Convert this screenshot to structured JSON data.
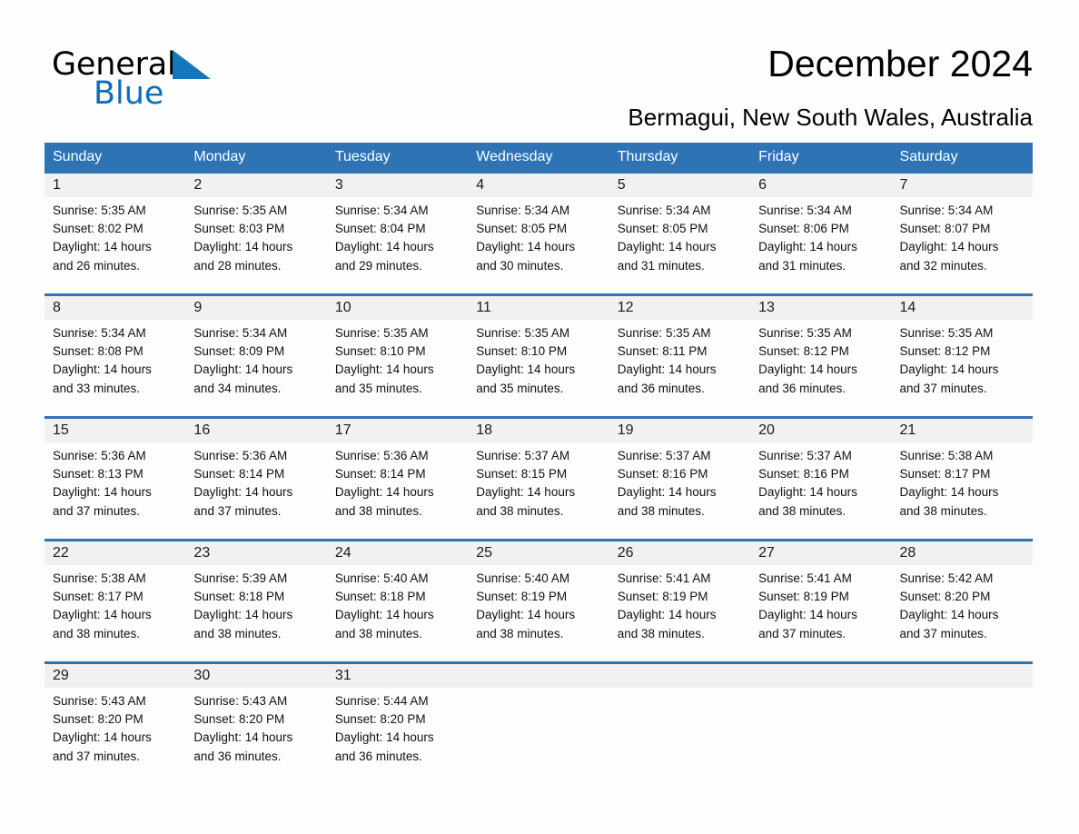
{
  "logo": {
    "text_general": "General",
    "text_blue": "Blue",
    "triangle_color": "#1476bc",
    "blue_color": "#0a6ebd"
  },
  "header": {
    "title": "December 2024",
    "subtitle": "Bermagui, New South Wales, Australia"
  },
  "theme": {
    "header_blue": "#2e74b5",
    "day_number_bg": "#f1f1f1",
    "page_bg": "#fdfdfd"
  },
  "calendar": {
    "day_names": [
      "Sunday",
      "Monday",
      "Tuesday",
      "Wednesday",
      "Thursday",
      "Friday",
      "Saturday"
    ],
    "weeks": [
      [
        {
          "day": "1",
          "sunrise": "Sunrise: 5:35 AM",
          "sunset": "Sunset: 8:02 PM",
          "daylight_line1": "Daylight: 14 hours",
          "daylight_line2": "and 26 minutes."
        },
        {
          "day": "2",
          "sunrise": "Sunrise: 5:35 AM",
          "sunset": "Sunset: 8:03 PM",
          "daylight_line1": "Daylight: 14 hours",
          "daylight_line2": "and 28 minutes."
        },
        {
          "day": "3",
          "sunrise": "Sunrise: 5:34 AM",
          "sunset": "Sunset: 8:04 PM",
          "daylight_line1": "Daylight: 14 hours",
          "daylight_line2": "and 29 minutes."
        },
        {
          "day": "4",
          "sunrise": "Sunrise: 5:34 AM",
          "sunset": "Sunset: 8:05 PM",
          "daylight_line1": "Daylight: 14 hours",
          "daylight_line2": "and 30 minutes."
        },
        {
          "day": "5",
          "sunrise": "Sunrise: 5:34 AM",
          "sunset": "Sunset: 8:05 PM",
          "daylight_line1": "Daylight: 14 hours",
          "daylight_line2": "and 31 minutes."
        },
        {
          "day": "6",
          "sunrise": "Sunrise: 5:34 AM",
          "sunset": "Sunset: 8:06 PM",
          "daylight_line1": "Daylight: 14 hours",
          "daylight_line2": "and 31 minutes."
        },
        {
          "day": "7",
          "sunrise": "Sunrise: 5:34 AM",
          "sunset": "Sunset: 8:07 PM",
          "daylight_line1": "Daylight: 14 hours",
          "daylight_line2": "and 32 minutes."
        }
      ],
      [
        {
          "day": "8",
          "sunrise": "Sunrise: 5:34 AM",
          "sunset": "Sunset: 8:08 PM",
          "daylight_line1": "Daylight: 14 hours",
          "daylight_line2": "and 33 minutes."
        },
        {
          "day": "9",
          "sunrise": "Sunrise: 5:34 AM",
          "sunset": "Sunset: 8:09 PM",
          "daylight_line1": "Daylight: 14 hours",
          "daylight_line2": "and 34 minutes."
        },
        {
          "day": "10",
          "sunrise": "Sunrise: 5:35 AM",
          "sunset": "Sunset: 8:10 PM",
          "daylight_line1": "Daylight: 14 hours",
          "daylight_line2": "and 35 minutes."
        },
        {
          "day": "11",
          "sunrise": "Sunrise: 5:35 AM",
          "sunset": "Sunset: 8:10 PM",
          "daylight_line1": "Daylight: 14 hours",
          "daylight_line2": "and 35 minutes."
        },
        {
          "day": "12",
          "sunrise": "Sunrise: 5:35 AM",
          "sunset": "Sunset: 8:11 PM",
          "daylight_line1": "Daylight: 14 hours",
          "daylight_line2": "and 36 minutes."
        },
        {
          "day": "13",
          "sunrise": "Sunrise: 5:35 AM",
          "sunset": "Sunset: 8:12 PM",
          "daylight_line1": "Daylight: 14 hours",
          "daylight_line2": "and 36 minutes."
        },
        {
          "day": "14",
          "sunrise": "Sunrise: 5:35 AM",
          "sunset": "Sunset: 8:12 PM",
          "daylight_line1": "Daylight: 14 hours",
          "daylight_line2": "and 37 minutes."
        }
      ],
      [
        {
          "day": "15",
          "sunrise": "Sunrise: 5:36 AM",
          "sunset": "Sunset: 8:13 PM",
          "daylight_line1": "Daylight: 14 hours",
          "daylight_line2": "and 37 minutes."
        },
        {
          "day": "16",
          "sunrise": "Sunrise: 5:36 AM",
          "sunset": "Sunset: 8:14 PM",
          "daylight_line1": "Daylight: 14 hours",
          "daylight_line2": "and 37 minutes."
        },
        {
          "day": "17",
          "sunrise": "Sunrise: 5:36 AM",
          "sunset": "Sunset: 8:14 PM",
          "daylight_line1": "Daylight: 14 hours",
          "daylight_line2": "and 38 minutes."
        },
        {
          "day": "18",
          "sunrise": "Sunrise: 5:37 AM",
          "sunset": "Sunset: 8:15 PM",
          "daylight_line1": "Daylight: 14 hours",
          "daylight_line2": "and 38 minutes."
        },
        {
          "day": "19",
          "sunrise": "Sunrise: 5:37 AM",
          "sunset": "Sunset: 8:16 PM",
          "daylight_line1": "Daylight: 14 hours",
          "daylight_line2": "and 38 minutes."
        },
        {
          "day": "20",
          "sunrise": "Sunrise: 5:37 AM",
          "sunset": "Sunset: 8:16 PM",
          "daylight_line1": "Daylight: 14 hours",
          "daylight_line2": "and 38 minutes."
        },
        {
          "day": "21",
          "sunrise": "Sunrise: 5:38 AM",
          "sunset": "Sunset: 8:17 PM",
          "daylight_line1": "Daylight: 14 hours",
          "daylight_line2": "and 38 minutes."
        }
      ],
      [
        {
          "day": "22",
          "sunrise": "Sunrise: 5:38 AM",
          "sunset": "Sunset: 8:17 PM",
          "daylight_line1": "Daylight: 14 hours",
          "daylight_line2": "and 38 minutes."
        },
        {
          "day": "23",
          "sunrise": "Sunrise: 5:39 AM",
          "sunset": "Sunset: 8:18 PM",
          "daylight_line1": "Daylight: 14 hours",
          "daylight_line2": "and 38 minutes."
        },
        {
          "day": "24",
          "sunrise": "Sunrise: 5:40 AM",
          "sunset": "Sunset: 8:18 PM",
          "daylight_line1": "Daylight: 14 hours",
          "daylight_line2": "and 38 minutes."
        },
        {
          "day": "25",
          "sunrise": "Sunrise: 5:40 AM",
          "sunset": "Sunset: 8:19 PM",
          "daylight_line1": "Daylight: 14 hours",
          "daylight_line2": "and 38 minutes."
        },
        {
          "day": "26",
          "sunrise": "Sunrise: 5:41 AM",
          "sunset": "Sunset: 8:19 PM",
          "daylight_line1": "Daylight: 14 hours",
          "daylight_line2": "and 38 minutes."
        },
        {
          "day": "27",
          "sunrise": "Sunrise: 5:41 AM",
          "sunset": "Sunset: 8:19 PM",
          "daylight_line1": "Daylight: 14 hours",
          "daylight_line2": "and 37 minutes."
        },
        {
          "day": "28",
          "sunrise": "Sunrise: 5:42 AM",
          "sunset": "Sunset: 8:20 PM",
          "daylight_line1": "Daylight: 14 hours",
          "daylight_line2": "and 37 minutes."
        }
      ],
      [
        {
          "day": "29",
          "sunrise": "Sunrise: 5:43 AM",
          "sunset": "Sunset: 8:20 PM",
          "daylight_line1": "Daylight: 14 hours",
          "daylight_line2": "and 37 minutes."
        },
        {
          "day": "30",
          "sunrise": "Sunrise: 5:43 AM",
          "sunset": "Sunset: 8:20 PM",
          "daylight_line1": "Daylight: 14 hours",
          "daylight_line2": "and 36 minutes."
        },
        {
          "day": "31",
          "sunrise": "Sunrise: 5:44 AM",
          "sunset": "Sunset: 8:20 PM",
          "daylight_line1": "Daylight: 14 hours",
          "daylight_line2": "and 36 minutes."
        },
        {
          "day": "",
          "sunrise": "",
          "sunset": "",
          "daylight_line1": "",
          "daylight_line2": ""
        },
        {
          "day": "",
          "sunrise": "",
          "sunset": "",
          "daylight_line1": "",
          "daylight_line2": ""
        },
        {
          "day": "",
          "sunrise": "",
          "sunset": "",
          "daylight_line1": "",
          "daylight_line2": ""
        },
        {
          "day": "",
          "sunrise": "",
          "sunset": "",
          "daylight_line1": "",
          "daylight_line2": ""
        }
      ]
    ]
  }
}
